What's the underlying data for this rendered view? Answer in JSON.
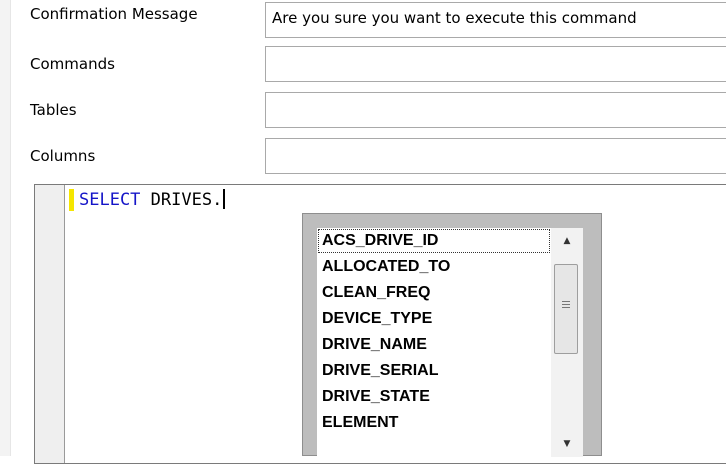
{
  "form": {
    "rows": [
      {
        "label": "Confirmation Message",
        "value": "Are you sure you want to execute this command"
      },
      {
        "label": "Commands",
        "value": ""
      },
      {
        "label": "Tables",
        "value": ""
      },
      {
        "label": "Columns",
        "value": ""
      }
    ]
  },
  "editor": {
    "keyword": "SELECT",
    "text_after_keyword": " DRIVES."
  },
  "autocomplete": {
    "items": [
      "ACS_DRIVE_ID",
      "ALLOCATED_TO",
      "CLEAN_FREQ",
      "DEVICE_TYPE",
      "DRIVE_NAME",
      "DRIVE_SERIAL",
      "DRIVE_STATE",
      "ELEMENT"
    ],
    "selected_item": "ACS_DRIVE_ID"
  },
  "icons": {
    "scroll_up": "scroll-up-arrow",
    "scroll_down": "scroll-down-arrow",
    "thumb_grip": "scrollbar-grip"
  }
}
